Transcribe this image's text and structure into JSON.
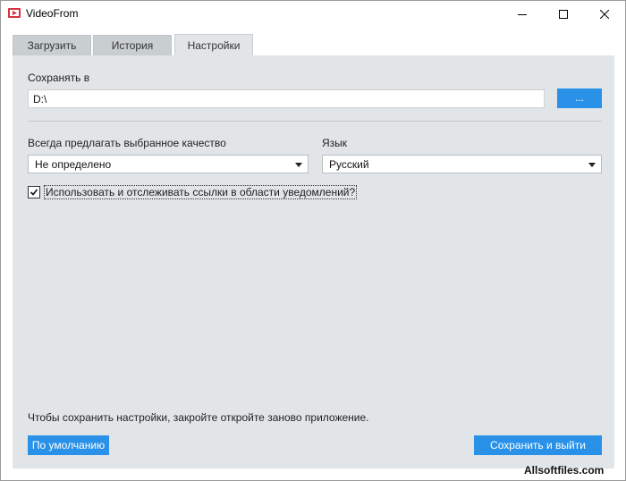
{
  "window": {
    "title": "VideoFrom",
    "icon": "videofrom-logo-icon",
    "controls": [
      "minimize-icon",
      "maximize-icon",
      "close-icon"
    ]
  },
  "tabs": [
    {
      "label": "Загрузить",
      "active": false
    },
    {
      "label": "История",
      "active": false
    },
    {
      "label": "Настройки",
      "active": true
    }
  ],
  "settings": {
    "save_to_label": "Сохранять в",
    "save_to_value": "D:\\",
    "browse_label": "...",
    "quality_label": "Всегда предлагать выбранное качество",
    "quality_value": "Не определено",
    "language_label": "Язык",
    "language_value": "Русский",
    "tray_checkbox_label": "Использовать и отслеживать ссылки в области уведомлений?",
    "tray_checkbox_checked": true,
    "hint": "Чтобы сохранить настройки, закройте  откройте заново приложение.",
    "default_button": "По умолчанию",
    "save_button": "Сохранить и выйти"
  },
  "watermark": "Allsoftfiles.com",
  "colors": {
    "accent": "#2a91e8",
    "panel": "#e1e5e8",
    "tab_inactive": "#c9ced1",
    "logo_red": "#d4343c"
  }
}
